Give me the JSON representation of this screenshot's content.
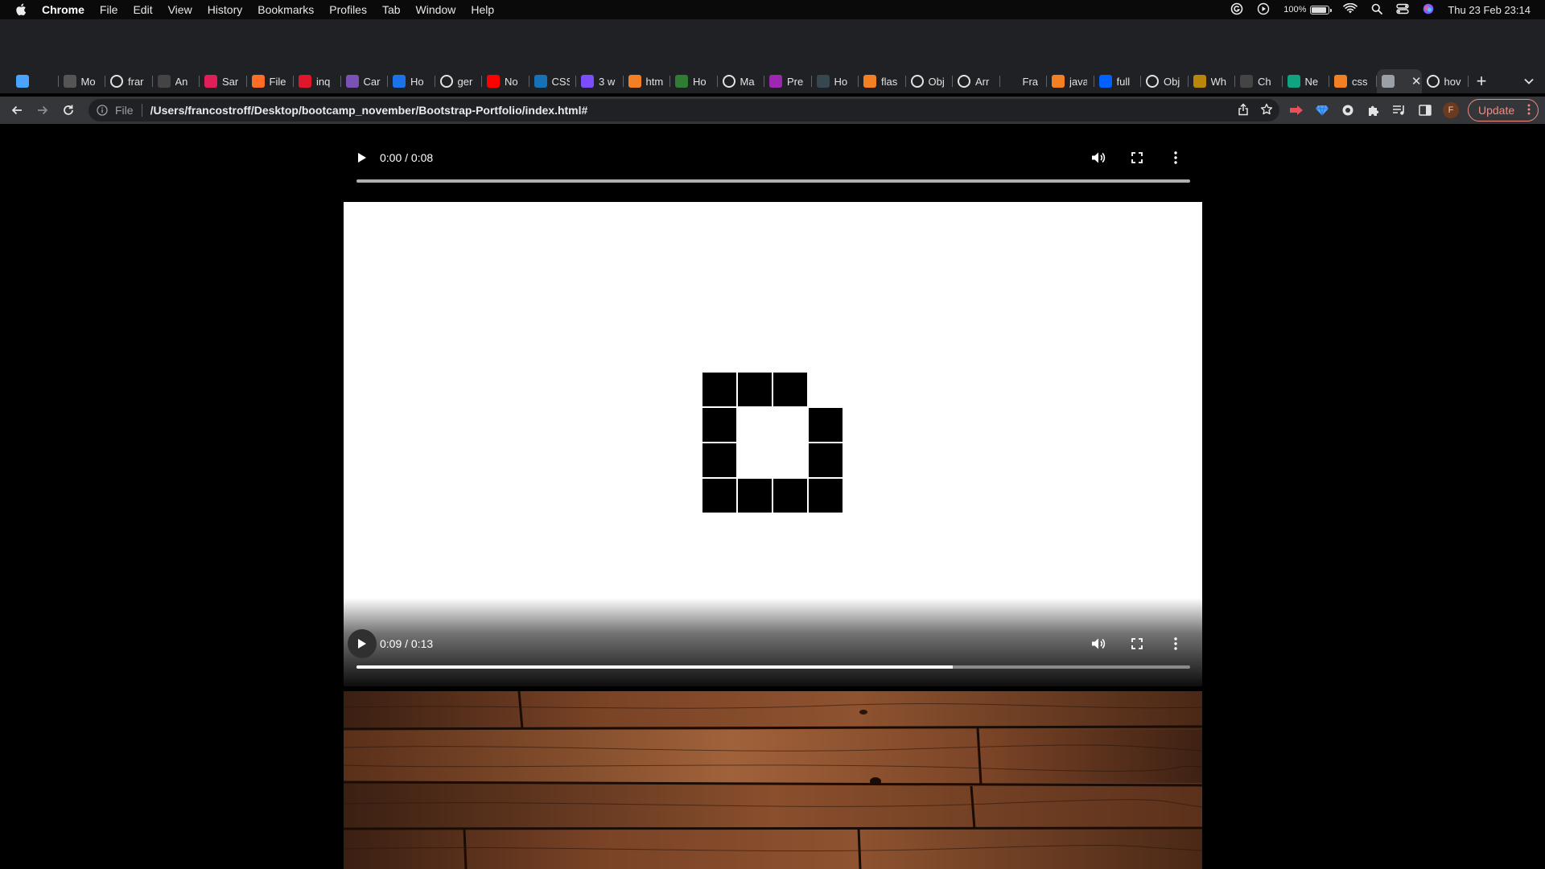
{
  "menubar": {
    "app": "Chrome",
    "items": [
      "File",
      "Edit",
      "View",
      "History",
      "Bookmarks",
      "Profiles",
      "Tab",
      "Window",
      "Help"
    ],
    "battery": "100%",
    "datetime": "Thu 23 Feb  23:14"
  },
  "tabs": [
    {
      "label": "",
      "icon": "gem-icon",
      "color": "#4aa3ff"
    },
    {
      "label": "Mo",
      "icon": "wix-icon",
      "color": "#555555"
    },
    {
      "label": "frar",
      "icon": "github-icon",
      "color": "#ffffff"
    },
    {
      "label": "An",
      "icon": "openai-icon",
      "color": "#444444"
    },
    {
      "label": "Sar",
      "icon": "slack-icon",
      "color": "#e01e5a"
    },
    {
      "label": "File",
      "icon": "gitlab-icon",
      "color": "#fc6d26"
    },
    {
      "label": "inq",
      "icon": "inq-icon",
      "color": "#e0162b"
    },
    {
      "label": "Car",
      "icon": "bootstrap-icon",
      "color": "#7952b3"
    },
    {
      "label": "Ho",
      "icon": "refresh-blue-icon",
      "color": "#1a73e8"
    },
    {
      "label": "ger",
      "icon": "google-icon",
      "color": "#ffffff"
    },
    {
      "label": "No",
      "icon": "youtube-icon",
      "color": "#ff0000"
    },
    {
      "label": "CSS",
      "icon": "css-icon",
      "color": "#1572b6"
    },
    {
      "label": "3 w",
      "icon": "a-icon",
      "color": "#7c4dff"
    },
    {
      "label": "htm",
      "icon": "stackoverflow-icon",
      "color": "#f48024"
    },
    {
      "label": "Ho",
      "icon": "link-icon",
      "color": "#2e7d32"
    },
    {
      "label": "Ma",
      "icon": "github-icon",
      "color": "#ffffff"
    },
    {
      "label": "Pre",
      "icon": "pen-icon",
      "color": "#9c27b0"
    },
    {
      "label": "Ho",
      "icon": "doc-icon",
      "color": "#37474f"
    },
    {
      "label": "flas",
      "icon": "stackoverflow-icon",
      "color": "#f48024"
    },
    {
      "label": "Obj",
      "icon": "mdn-icon",
      "color": "#ffffff"
    },
    {
      "label": "Arr",
      "icon": "mdn-icon",
      "color": "#ffffff"
    },
    {
      "label": "Fra",
      "icon": "blank-icon",
      "color": "#202124"
    },
    {
      "label": "java",
      "icon": "stackoverflow-icon",
      "color": "#f48024"
    },
    {
      "label": "full",
      "icon": "dropbox-icon",
      "color": "#0061ff"
    },
    {
      "label": "Obj",
      "icon": "mdn-icon",
      "color": "#ffffff"
    },
    {
      "label": "Wh",
      "icon": "glasses-icon",
      "color": "#b8860b"
    },
    {
      "label": "Ch",
      "icon": "openai-icon",
      "color": "#444444"
    },
    {
      "label": "Ne",
      "icon": "chatgpt-icon",
      "color": "#10a37f"
    },
    {
      "label": "css",
      "icon": "stackoverflow-icon",
      "color": "#f48024"
    },
    {
      "label": "",
      "icon": "globe-icon",
      "color": "#9aa0a6",
      "active": true
    },
    {
      "label": "hov",
      "icon": "google-icon",
      "color": "#ffffff"
    }
  ],
  "toolbar": {
    "scheme": "File",
    "url": "/Users/francostroff/Desktop/bootcamp_november/Bootstrap-Portfolio/index.html#",
    "avatar_initial": "F",
    "update_label": "Update"
  },
  "media": {
    "audio1": {
      "time": "0:00 / 0:08",
      "progress": 0.0
    },
    "video2": {
      "time": "0:09 / 0:13",
      "progress": 0.715
    }
  },
  "colors": {
    "page_bg": "#000000",
    "update_accent": "#f28b82",
    "wood": "#6b3a22"
  }
}
